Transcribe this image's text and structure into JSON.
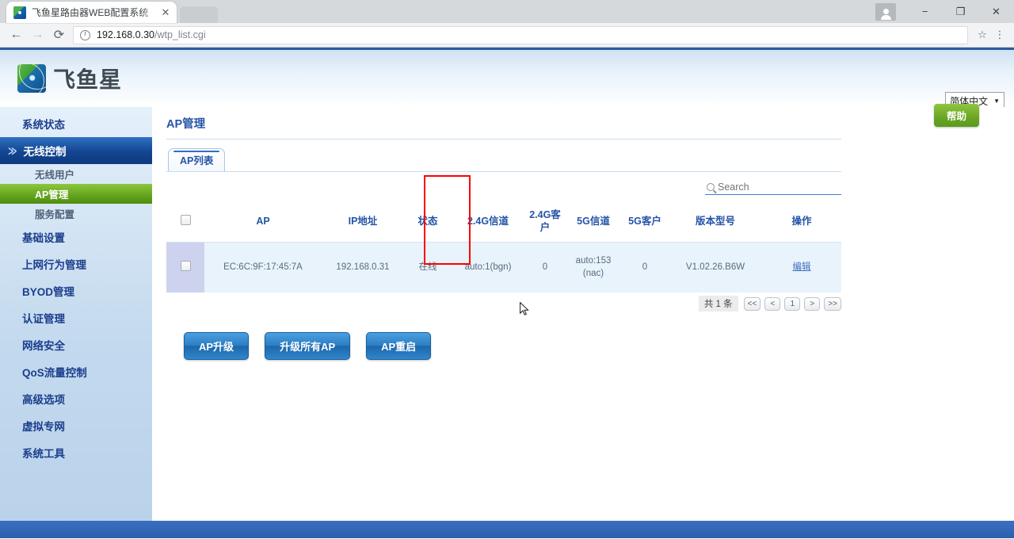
{
  "browser": {
    "tab_title": "飞鱼星路由器WEB配置系统",
    "tab_close": "✕",
    "back_icon": "←",
    "forward_icon": "→",
    "reload_icon": "⟳",
    "url_host": "192.168.0.30",
    "url_path": "/wtp_list.cgi",
    "star_icon": "☆",
    "menu_icon": "⋮",
    "minimize_icon": "−",
    "maximize_icon": "❐",
    "close_icon": "✕"
  },
  "header": {
    "brand": "飞鱼星",
    "language": "简体中文",
    "language_caret": "▼"
  },
  "sidebar": {
    "items": [
      {
        "label": "系统状态",
        "type": "top",
        "state": "normal"
      },
      {
        "label": "无线控制",
        "type": "top",
        "state": "open"
      },
      {
        "label": "无线用户",
        "type": "sub",
        "state": "normal"
      },
      {
        "label": "AP管理",
        "type": "sub",
        "state": "active"
      },
      {
        "label": "服务配置",
        "type": "sub",
        "state": "normal"
      },
      {
        "label": "基础设置",
        "type": "top",
        "state": "normal"
      },
      {
        "label": "上网行为管理",
        "type": "top",
        "state": "normal"
      },
      {
        "label": "BYOD管理",
        "type": "top",
        "state": "normal"
      },
      {
        "label": "认证管理",
        "type": "top",
        "state": "normal"
      },
      {
        "label": "网络安全",
        "type": "top",
        "state": "normal"
      },
      {
        "label": "QoS流量控制",
        "type": "top",
        "state": "normal"
      },
      {
        "label": "高级选项",
        "type": "top",
        "state": "normal"
      },
      {
        "label": "虚拟专网",
        "type": "top",
        "state": "normal"
      },
      {
        "label": "系统工具",
        "type": "top",
        "state": "normal"
      }
    ],
    "chevron": "≫"
  },
  "main": {
    "page_title": "AP管理",
    "help_label": "帮助",
    "tab_label": "AP列表",
    "search_placeholder": "Search",
    "search_value": "",
    "table": {
      "columns": [
        "",
        "AP",
        "IP地址",
        "状态",
        "2.4G信道",
        "2.4G客户",
        "5G信道",
        "5G客户",
        "版本型号",
        "操作"
      ],
      "rows": [
        {
          "ap": "EC:6C:9F:17:45:7A",
          "ip": "192.168.0.31",
          "status": "在线",
          "ch24": "auto:1(bgn)",
          "cli24": "0",
          "ch5": "auto:153 (nac)",
          "cli5": "0",
          "version": "V1.02.26.B6W",
          "action": "编辑"
        }
      ]
    },
    "pagination": {
      "count_label": "共 1 条",
      "first": "<<",
      "prev": "<",
      "current": "1",
      "next": ">",
      "last": ">>"
    },
    "buttons": [
      {
        "label": "AP升级"
      },
      {
        "label": "升级所有AP"
      },
      {
        "label": "AP重启"
      }
    ]
  },
  "annotation": {
    "highlight_color": "#ff0000",
    "highlight_target": "状态"
  }
}
